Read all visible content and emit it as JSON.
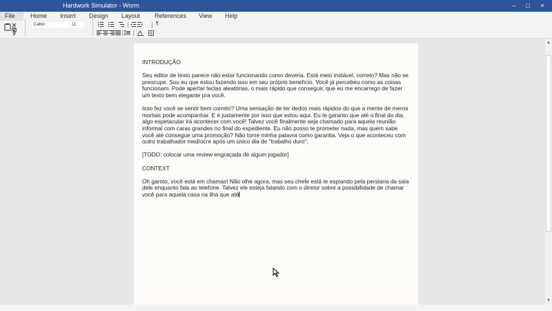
{
  "window": {
    "title": "Hardwork Simulator - Worm",
    "minimize_icon": "–",
    "maximize_icon": "□",
    "close_icon": "×"
  },
  "menu": {
    "file": "File",
    "home": "Home",
    "insert": "Insert",
    "design": "Design",
    "layout": "Layout",
    "references": "References",
    "view": "View",
    "help": "Help"
  },
  "ribbon": {
    "font_name": "Calibri",
    "font_size": "11",
    "pilcrow": "¶"
  },
  "document": {
    "heading1": "INTRODUÇÃO",
    "para1": "Seu editor de texto parece não estar funcionando como deveria. Está meio instável, correto? Mas não se preocupe. Sou eu que estou fazendo isso em seu próprio benefício. Você já percebeu como as coisas funcionam. Pode apertar teclas aleatórias, o mais rápido que conseguir, que eu me encarrego de fazer um texto bem elegante pra você.",
    "para2": "Isso fez você se sentir bem correto? Uma sensação de ter dedos mais rápidos do que a mente de meros mortais pode acompanhar. E é justamente por isso que estou aqui. Eu te garanto que até o final do dia, algo espetacular irá acontecer com você! Talvez você finalmente seja chamado para aquela reunião informal com caras grandes no final do expediente. Eu não posso te prometer nada, mas quem sabe você até consegue uma promoção? Não tome minha palavra como garantia. Veja o que aconteceu com outro trabalhador medíocre após um único dia de \"trabalho duro\":",
    "todo": "[TODO: colocar uma review engraçada de algum jogador]",
    "heading2": "CONTEXT",
    "para3": "Oh garoto, você está em chamas! Não olhe agora, mas seu chefe está te espiando pela persiana da sala dele enquanto fala ao telefone. Talvez ele esteja falando com o diretor sobre a possibilidade de chamar você para aquela casa na ilha que até"
  },
  "icons": {
    "paste": "paste-icon",
    "cut": "cut-icon",
    "copy": "copy-icon",
    "format_painter": "format-painter-icon",
    "cursor": "mouse-cursor-icon"
  }
}
